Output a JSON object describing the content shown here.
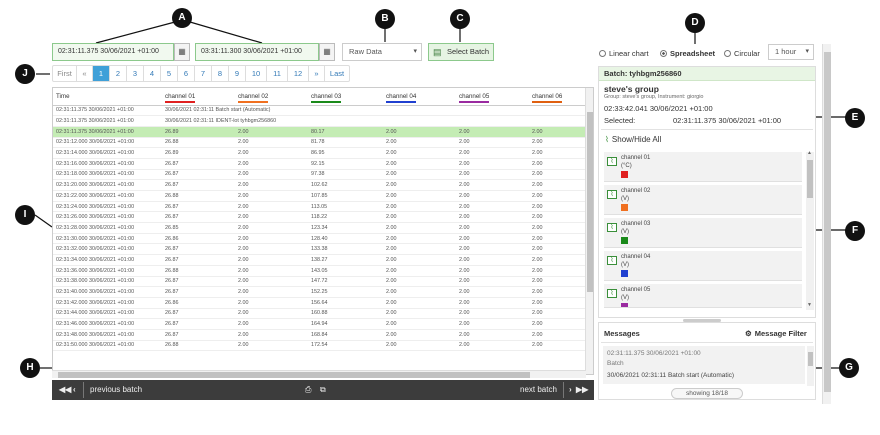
{
  "toolbar": {
    "start_time": "02:31:11.375 30/06/2021 +01:00",
    "end_time": "03:31:11.300 30/06/2021 +01:00",
    "data_mode": "Raw Data",
    "select_batch_label": "Select Batch",
    "view_options": [
      {
        "label": "Linear chart",
        "selected": false
      },
      {
        "label": "Spreadsheet",
        "selected": true
      },
      {
        "label": "Circular",
        "selected": false
      }
    ],
    "range": "1 hour"
  },
  "callouts": [
    "A",
    "B",
    "C",
    "D",
    "E",
    "F",
    "G",
    "H",
    "I",
    "J"
  ],
  "pagination": {
    "first": "First",
    "prev": "«",
    "pages": [
      "1",
      "2",
      "3",
      "4",
      "5",
      "6",
      "7",
      "8",
      "9",
      "10",
      "11",
      "12"
    ],
    "current": "1",
    "next": "»",
    "last": "Last"
  },
  "table": {
    "columns": [
      {
        "label": "Time",
        "color": ""
      },
      {
        "label": "channel 01",
        "color": "#e02020"
      },
      {
        "label": "channel 02",
        "color": "#f07020"
      },
      {
        "label": "channel 03",
        "color": "#1a8a1a"
      },
      {
        "label": "channel 04",
        "color": "#2040d0"
      },
      {
        "label": "channel 05",
        "color": "#9a2aa0"
      },
      {
        "label": "channel 06",
        "color": "#e06010"
      }
    ],
    "notes": [
      {
        "time": "02:31:11.375 30/06/2021 +01:00",
        "text": "30/06/2021 02:31:11 Batch start (Automatic)"
      },
      {
        "time": "02:31:11.375 30/06/2021 +01:00",
        "text": "30/06/2021 02:31:11 IDENT-lot tyhbgm256860"
      }
    ],
    "rows": [
      [
        "02:31:11.375 30/06/2021 +01:00",
        "26.89",
        "2.00",
        "80.17",
        "2.00",
        "2.00",
        "2.00"
      ],
      [
        "02:31:12.000 30/06/2021 +01:00",
        "26.88",
        "2.00",
        "81.78",
        "2.00",
        "2.00",
        "2.00"
      ],
      [
        "02:31:14.000 30/06/2021 +01:00",
        "26.89",
        "2.00",
        "86.95",
        "2.00",
        "2.00",
        "2.00"
      ],
      [
        "02:31:16.000 30/06/2021 +01:00",
        "26.87",
        "2.00",
        "92.15",
        "2.00",
        "2.00",
        "2.00"
      ],
      [
        "02:31:18.000 30/06/2021 +01:00",
        "26.87",
        "2.00",
        "97.38",
        "2.00",
        "2.00",
        "2.00"
      ],
      [
        "02:31:20.000 30/06/2021 +01:00",
        "26.87",
        "2.00",
        "102.62",
        "2.00",
        "2.00",
        "2.00"
      ],
      [
        "02:31:22.000 30/06/2021 +01:00",
        "26.88",
        "2.00",
        "107.85",
        "2.00",
        "2.00",
        "2.00"
      ],
      [
        "02:31:24.000 30/06/2021 +01:00",
        "26.87",
        "2.00",
        "113.05",
        "2.00",
        "2.00",
        "2.00"
      ],
      [
        "02:31:26.000 30/06/2021 +01:00",
        "26.87",
        "2.00",
        "118.22",
        "2.00",
        "2.00",
        "2.00"
      ],
      [
        "02:31:28.000 30/06/2021 +01:00",
        "26.85",
        "2.00",
        "123.34",
        "2.00",
        "2.00",
        "2.00"
      ],
      [
        "02:31:30.000 30/06/2021 +01:00",
        "26.86",
        "2.00",
        "128.40",
        "2.00",
        "2.00",
        "2.00"
      ],
      [
        "02:31:32.000 30/06/2021 +01:00",
        "26.87",
        "2.00",
        "133.38",
        "2.00",
        "2.00",
        "2.00"
      ],
      [
        "02:31:34.000 30/06/2021 +01:00",
        "26.87",
        "2.00",
        "138.27",
        "2.00",
        "2.00",
        "2.00"
      ],
      [
        "02:31:36.000 30/06/2021 +01:00",
        "26.88",
        "2.00",
        "143.05",
        "2.00",
        "2.00",
        "2.00"
      ],
      [
        "02:31:38.000 30/06/2021 +01:00",
        "26.87",
        "2.00",
        "147.72",
        "2.00",
        "2.00",
        "2.00"
      ],
      [
        "02:31:40.000 30/06/2021 +01:00",
        "26.87",
        "2.00",
        "152.25",
        "2.00",
        "2.00",
        "2.00"
      ],
      [
        "02:31:42.000 30/06/2021 +01:00",
        "26.86",
        "2.00",
        "156.64",
        "2.00",
        "2.00",
        "2.00"
      ],
      [
        "02:31:44.000 30/06/2021 +01:00",
        "26.87",
        "2.00",
        "160.88",
        "2.00",
        "2.00",
        "2.00"
      ],
      [
        "02:31:46.000 30/06/2021 +01:00",
        "26.87",
        "2.00",
        "164.94",
        "2.00",
        "2.00",
        "2.00"
      ],
      [
        "02:31:48.000 30/06/2021 +01:00",
        "26.87",
        "2.00",
        "168.84",
        "2.00",
        "2.00",
        "2.00"
      ],
      [
        "02:31:50.000 30/06/2021 +01:00",
        "26.88",
        "2.00",
        "172.54",
        "2.00",
        "2.00",
        "2.00"
      ]
    ],
    "highlight_row": 0
  },
  "batch_nav": {
    "prev_label": "previous batch",
    "next_label": "next batch"
  },
  "batch_panel": {
    "batch_label": "Batch: tyhbgm256860",
    "group_name": "steve's group",
    "group_detail": "Group: steve's group,  Instrument: giorgio",
    "start": "02:33:42.041 30/06/2021 +01:00",
    "selected_label": "Selected:",
    "selected_value": "02:31:11.375 30/06/2021 +01:00",
    "show_hide_label": "Show/Hide All",
    "channels": [
      {
        "name": "channel 01",
        "unit": "(°C)",
        "color": "#e02020"
      },
      {
        "name": "channel 02",
        "unit": "(V)",
        "color": "#f07020"
      },
      {
        "name": "channel 03",
        "unit": "(V)",
        "color": "#1a8a1a"
      },
      {
        "name": "channel 04",
        "unit": "(V)",
        "color": "#2040d0"
      },
      {
        "name": "channel 05",
        "unit": "(V)",
        "color": "#9a2aa0"
      }
    ]
  },
  "messages": {
    "title": "Messages",
    "filter_label": "Message Filter",
    "items": [
      {
        "time": "02:31:11.375 30/06/2021 +01:00",
        "type": "Batch",
        "text": "30/06/2021 02:31:11 Batch start (Automatic)"
      }
    ],
    "showing": "showing 18/18"
  }
}
